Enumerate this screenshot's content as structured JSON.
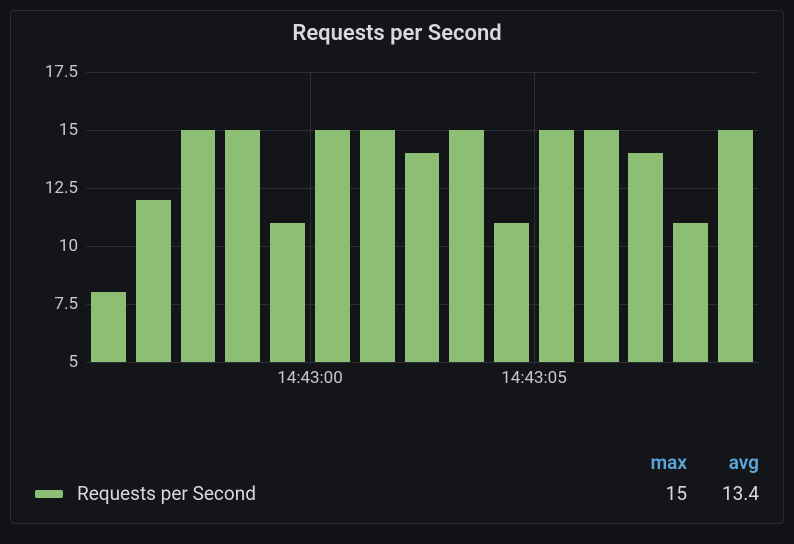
{
  "chart_data": {
    "type": "bar",
    "title": "Requests per Second",
    "ylabel": "",
    "xlabel": "",
    "ylim": [
      5,
      17.5
    ],
    "y_ticks": [
      5,
      7.5,
      10,
      12.5,
      15,
      17.5
    ],
    "x_tick_labels": [
      "14:43:00",
      "14:43:05"
    ],
    "x_tick_positions": [
      5,
      10
    ],
    "values": [
      8,
      12,
      15,
      15,
      11,
      15,
      15,
      14,
      15,
      11,
      15,
      15,
      14,
      11,
      15
    ],
    "series_name": "Requests per Second",
    "bar_color": "#8cbf73"
  },
  "legend": {
    "headers": {
      "max": "max",
      "avg": "avg"
    },
    "rows": [
      {
        "label": "Requests per Second",
        "max": "15",
        "avg": "13.4"
      }
    ]
  }
}
